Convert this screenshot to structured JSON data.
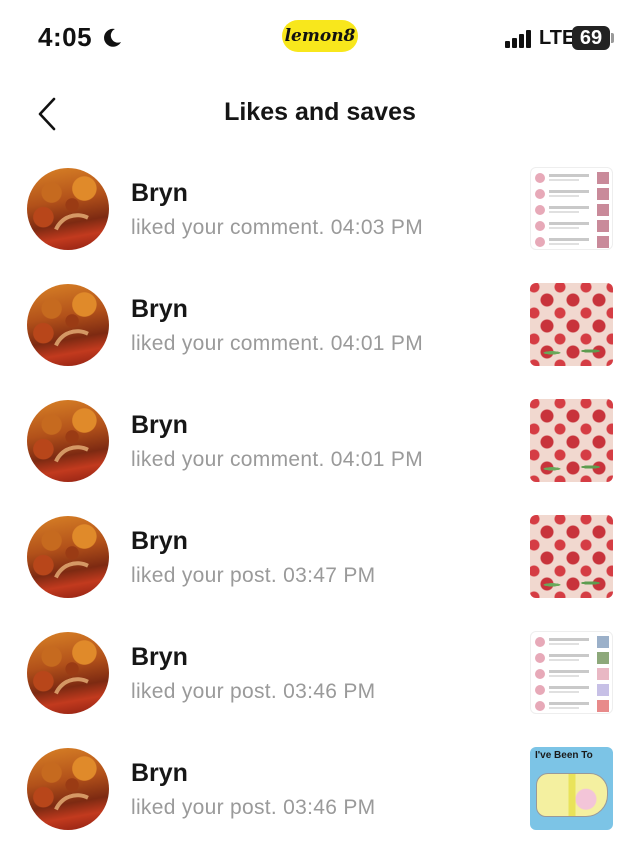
{
  "status_bar": {
    "time": "4:05",
    "network": "LTE",
    "battery": "69",
    "app_badge": "lemon8"
  },
  "header": {
    "title": "Likes and saves"
  },
  "notifications": [
    {
      "name": "Bryn",
      "action": "liked your comment. 04:03 PM",
      "thumb": "listing"
    },
    {
      "name": "Bryn",
      "action": "liked your comment. 04:01 PM",
      "thumb": "strawberry"
    },
    {
      "name": "Bryn",
      "action": "liked your comment. 04:01 PM",
      "thumb": "strawberry"
    },
    {
      "name": "Bryn",
      "action": "liked your post. 03:47 PM",
      "thumb": "strawberry"
    },
    {
      "name": "Bryn",
      "action": "liked your post. 03:46 PM",
      "thumb": "listing"
    },
    {
      "name": "Bryn",
      "action": "liked your post. 03:46 PM",
      "thumb": "map"
    }
  ],
  "map_thumb": {
    "title": "I've Been To"
  }
}
